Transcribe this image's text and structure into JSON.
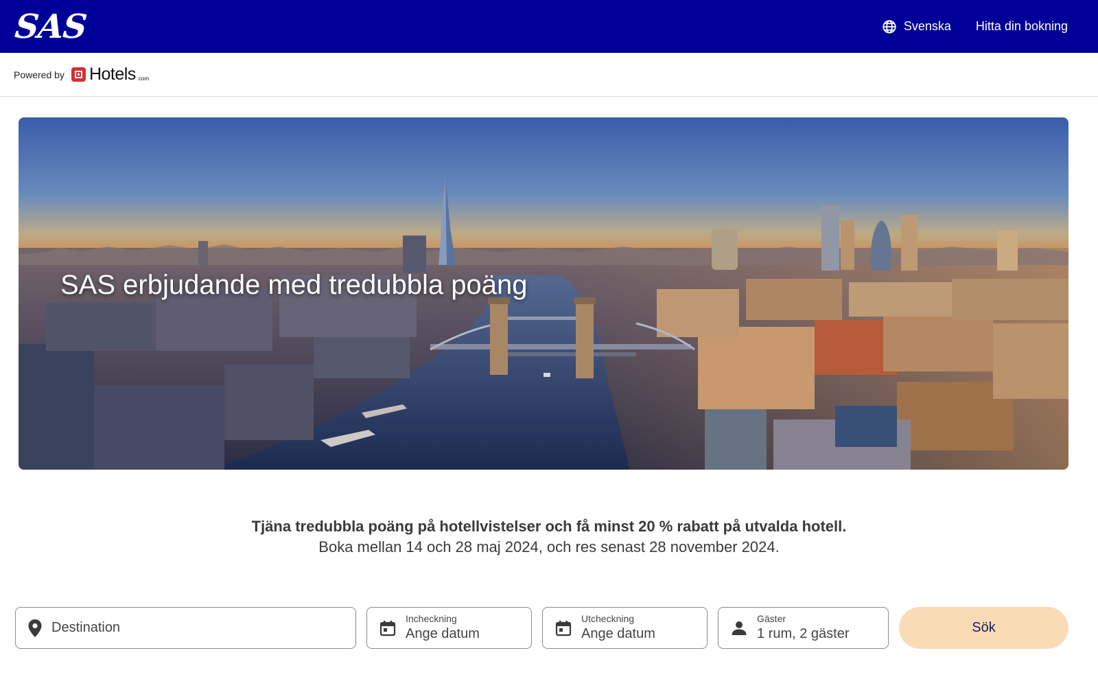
{
  "header": {
    "logo_text": "SAS",
    "language_label": "Svenska",
    "language_icon": "globe-icon",
    "find_booking_label": "Hitta din bokning",
    "brand_color": "#000099"
  },
  "powered_by": {
    "label": "Powered by",
    "partner_name": "Hotels",
    "partner_suffix": ".com"
  },
  "hero": {
    "title": "SAS erbjudande med tredubbla poäng"
  },
  "promo": {
    "headline": "Tjäna tredubbla poäng på hotellvistelser och få minst 20 % rabatt på utvalda hotell.",
    "subline": "Boka mellan 14 och 28 maj 2024, och res senast 28 november 2024."
  },
  "search": {
    "destination_placeholder": "Destination",
    "destination_icon": "location-pin-icon",
    "checkin_label": "Incheckning",
    "checkin_value": "Ange datum",
    "checkout_label": "Utcheckning",
    "checkout_value": "Ange datum",
    "calendar_icon": "calendar-icon",
    "guests_label": "Gäster",
    "guests_value": "1 rum, 2 gäster",
    "guests_icon": "person-icon",
    "submit_label": "Sök",
    "submit_color": "#f9dcb6"
  }
}
